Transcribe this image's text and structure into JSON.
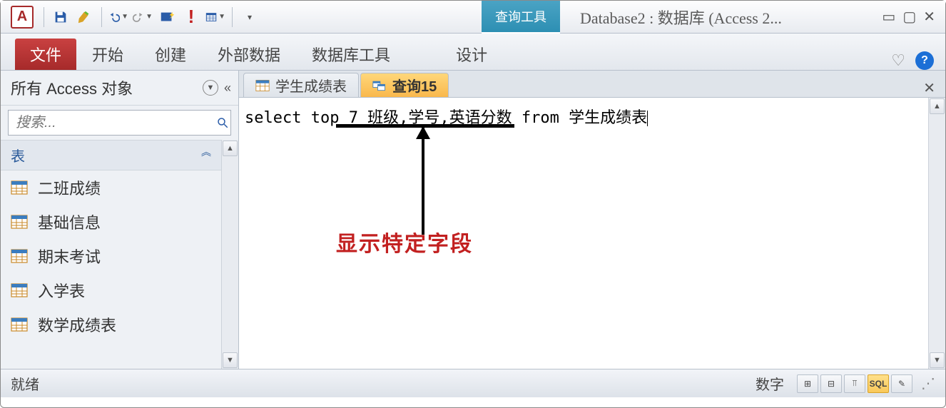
{
  "qat": {
    "logo_letter": "A"
  },
  "titlebar": {
    "contextual_label": "查询工具",
    "title": "Database2 : 数据库 (Access 2..."
  },
  "ribbon": {
    "file": "文件",
    "tabs": [
      "开始",
      "创建",
      "外部数据",
      "数据库工具",
      "设计"
    ]
  },
  "navpane": {
    "header": "所有 Access 对象",
    "search_placeholder": "搜索...",
    "group_label": "表",
    "items": [
      "二班成绩",
      "基础信息",
      "期末考试",
      "入学表",
      "数学成绩表"
    ]
  },
  "doc": {
    "tabs": [
      {
        "label": "学生成绩表",
        "active": false,
        "icon": "table"
      },
      {
        "label": "查询15",
        "active": true,
        "icon": "query"
      }
    ],
    "sql": "select top 7 班级,学号,英语分数 from 学生成绩表",
    "annotation": "显示特定字段"
  },
  "statusbar": {
    "left": "就绪",
    "right_label": "数字",
    "views": [
      {
        "name": "datasheet-view",
        "label": "⊞",
        "active": false
      },
      {
        "name": "pivot-table-view",
        "label": "⊟",
        "active": false
      },
      {
        "name": "pivot-chart-view",
        "label": "⫪",
        "active": false
      },
      {
        "name": "sql-view",
        "label": "SQL",
        "active": true
      },
      {
        "name": "design-view",
        "label": "✎",
        "active": false
      }
    ]
  }
}
